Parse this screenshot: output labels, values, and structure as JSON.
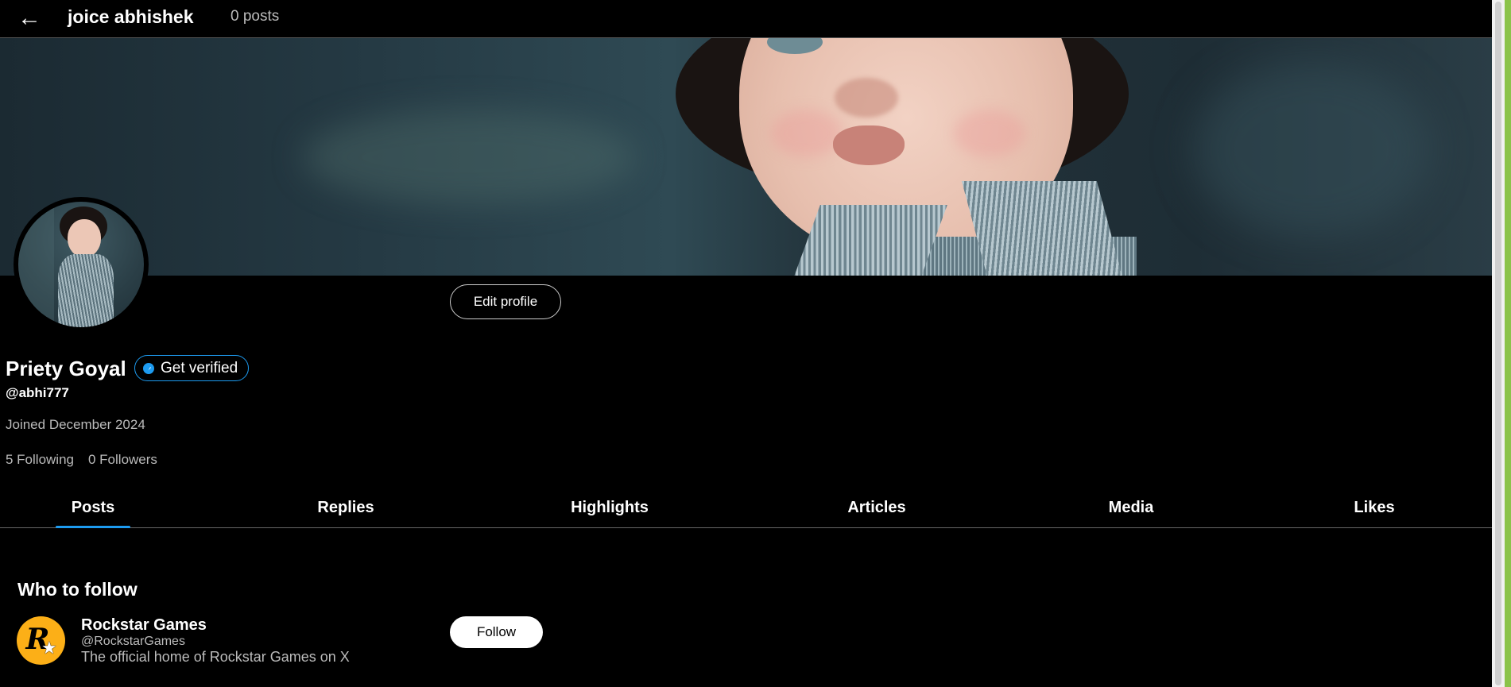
{
  "header": {
    "back_icon": "←",
    "title": "joice abhishek",
    "post_count": "0 posts"
  },
  "profile": {
    "edit_label": "Edit profile",
    "display_name": "Priety Goyal",
    "verify_label": "Get verified",
    "handle": "@abhi777",
    "joined": "Joined December 2024",
    "following": "5 Following",
    "followers": "0 Followers"
  },
  "tabs": [
    {
      "label": "Posts",
      "active": true
    },
    {
      "label": "Replies"
    },
    {
      "label": "Highlights"
    },
    {
      "label": "Articles"
    },
    {
      "label": "Media"
    },
    {
      "label": "Likes"
    }
  ],
  "who_to_follow": {
    "title": "Who to follow",
    "accounts": [
      {
        "name": "Rockstar Games",
        "handle": "@RockstarGames",
        "bio": "The official home of Rockstar Games on X",
        "logo_letter": "R",
        "logo_star": "★",
        "follow_label": "Follow"
      }
    ]
  },
  "colors": {
    "accent": "#1d9bf0",
    "background": "#000000",
    "rockstar_yellow": "#fcaf17"
  }
}
